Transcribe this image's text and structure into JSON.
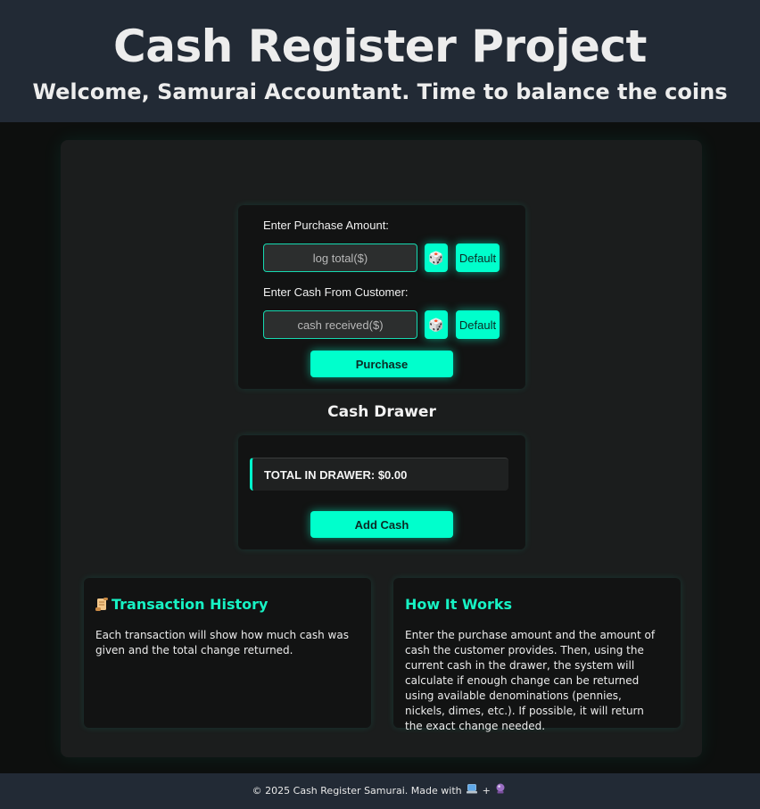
{
  "header": {
    "title": "Cash Register Project",
    "subtitle": "Welcome, Samurai Accountant. Time to balance the coins"
  },
  "purchase_form": {
    "purchase_label": "Enter Purchase Amount:",
    "purchase_placeholder": "log total($)",
    "purchase_value": "",
    "cash_label": "Enter Cash From Customer:",
    "cash_placeholder": "cash received($)",
    "cash_value": "",
    "dice_icon": "dice-icon",
    "random_button_label": "🎲",
    "default_button_label": "Default",
    "purchase_button_label": "Purchase"
  },
  "drawer": {
    "title": "Cash Drawer",
    "total_text": "TOTAL IN DRAWER: $0.00",
    "add_cash_label": "Add Cash"
  },
  "history": {
    "icon": "scroll-icon",
    "title": "Transaction History",
    "body": "Each transaction will show how much cash was given and the total change returned."
  },
  "how_it_works": {
    "title": "How It Works",
    "body": "Enter the purchase amount and the amount of cash the customer provides. Then, using the current cash in the drawer, the system will calculate if enough change can be returned using available denominations (pennies, nickels, dimes, etc.). If possible, it will return the exact change needed."
  },
  "footer": {
    "text": "© 2025 Cash Register Samurai. Made with",
    "plus": "+",
    "icons": [
      "laptop-icon",
      "crystal-ball-icon"
    ]
  },
  "colors": {
    "accent": "#00ffcc",
    "header_bg": "#222a35",
    "page_bg": "#0d0f0e",
    "panel_bg": "#1b1d1d",
    "card_bg": "#121313"
  }
}
